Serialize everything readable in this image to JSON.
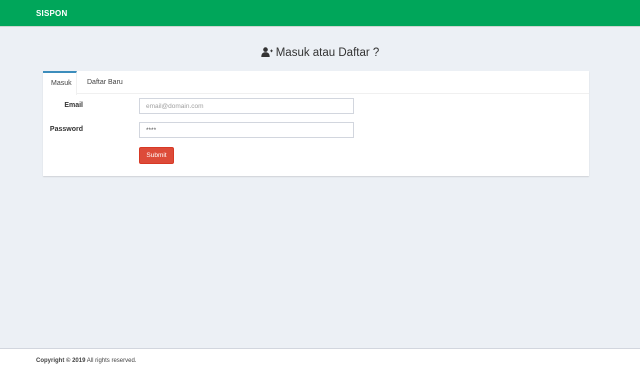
{
  "header": {
    "brand": "SISPON"
  },
  "page": {
    "title": "Masuk atau Daftar ?",
    "title_icon": "user-plus-icon"
  },
  "tabs": [
    {
      "label": "Masuk",
      "active": true
    },
    {
      "label": "Daftar Baru",
      "active": false
    }
  ],
  "form": {
    "email_label": "Email",
    "email_placeholder": "email@domain.com",
    "email_value": "",
    "password_label": "Password",
    "password_value": "****",
    "submit_label": "Submit"
  },
  "footer": {
    "copyright": "Copyright © 2019",
    "rights": " All rights reserved."
  },
  "colors": {
    "header": "#00a65a",
    "active_tab": "#3c8dbc",
    "submit": "#dd4b39",
    "background": "#ecf0f5"
  }
}
